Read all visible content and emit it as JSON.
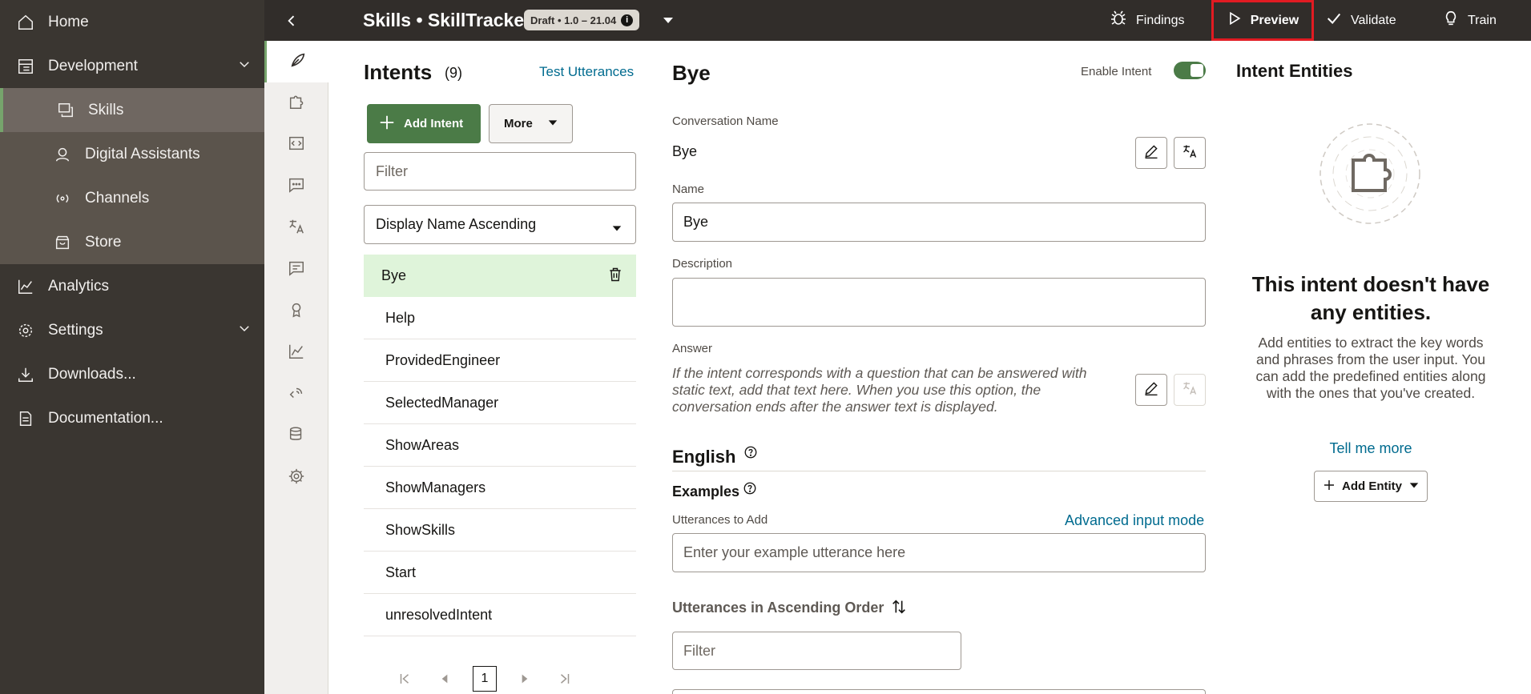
{
  "nav": {
    "items": [
      {
        "label": "Home",
        "icon": "home-icon"
      },
      {
        "label": "Development",
        "icon": "development-icon"
      },
      {
        "label": "Skills",
        "icon": "skills-icon"
      },
      {
        "label": "Digital Assistants",
        "icon": "digital-assistants-icon"
      },
      {
        "label": "Channels",
        "icon": "channels-icon"
      },
      {
        "label": "Store",
        "icon": "store-icon"
      },
      {
        "label": "Analytics",
        "icon": "analytics-icon"
      },
      {
        "label": "Settings",
        "icon": "settings-icon"
      },
      {
        "label": "Downloads...",
        "icon": "download-icon"
      },
      {
        "label": "Documentation...",
        "icon": "documentation-icon"
      }
    ]
  },
  "topbar": {
    "title": "Skills • SkillTracker",
    "draft_badge": "Draft • 1.0 – 21.04",
    "findings": "Findings",
    "preview": "Preview",
    "validate": "Validate",
    "train": "Train"
  },
  "intents": {
    "title": "Intents",
    "count": "(9)",
    "test_utterances": "Test Utterances",
    "add_intent": "Add Intent",
    "more": "More",
    "filter_placeholder": "Filter",
    "sort_value": "Display Name Ascending",
    "list": [
      "Bye",
      "Help",
      "ProvidedEngineer",
      "SelectedManager",
      "ShowAreas",
      "ShowManagers",
      "ShowSkills",
      "Start",
      "unresolvedIntent"
    ],
    "selected_index": 0,
    "page": "1"
  },
  "detail": {
    "title": "Bye",
    "enable_intent_label": "Enable Intent",
    "enable_intent": true,
    "conversation_name_label": "Conversation Name",
    "conversation_name": "Bye",
    "name_label": "Name",
    "name_value": "Bye",
    "description_label": "Description",
    "description_value": "",
    "answer_label": "Answer",
    "answer_placeholder": "If the intent corresponds with a question that can be answered with static text, add that text here. When you use this option, the conversation ends after the answer text is displayed.",
    "english_title": "English",
    "examples_title": "Examples",
    "utterances_to_add_label": "Utterances to Add",
    "advanced_input_mode": "Advanced input mode",
    "utterance_placeholder": "Enter your example utterance here",
    "utterances_order_title": "Utterances in Ascending Order",
    "utterances_filter_placeholder": "Filter"
  },
  "entities": {
    "title": "Intent Entities",
    "empty_title": "This intent doesn't have any entities.",
    "empty_desc": "Add entities to extract the key words and phrases from the user input. You can add the predefined entities along with the ones that you've created.",
    "tell_me_more": "Tell me more",
    "add_entity": "Add Entity"
  },
  "colors": {
    "nav_bg": "#3a3631",
    "topbar_bg": "#312d2a",
    "accent_green": "#4b7b47",
    "link_blue": "#006b8f",
    "selected_row": "#dff4da",
    "highlight_red": "#e11b22"
  }
}
